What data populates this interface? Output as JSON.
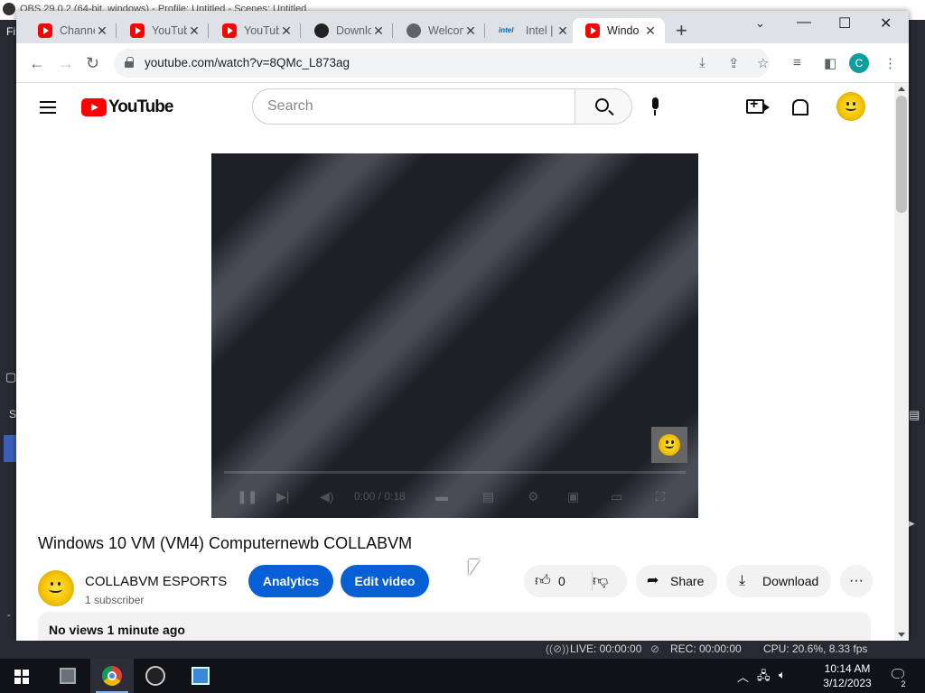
{
  "obs": {
    "title": "OBS 29.0.2 (64-bit, windows) - Profile: Untitled - Scenes: Untitled",
    "menu_label": "Fi",
    "status": {
      "live": "LIVE: 00:00:00",
      "rec": "REC: 00:00:00",
      "cpu": "CPU: 20.6%, 8.33 fps"
    }
  },
  "browser": {
    "tabs": [
      {
        "label": "Channel",
        "favicon": "youtube-icon"
      },
      {
        "label": "YouTube",
        "favicon": "youtube-icon"
      },
      {
        "label": "YouTube",
        "favicon": "youtube-icon"
      },
      {
        "label": "Download",
        "favicon": "obs-icon"
      },
      {
        "label": "Welcome",
        "favicon": "globe-icon"
      },
      {
        "label": "Intel | D",
        "favicon": "intel-icon"
      },
      {
        "label": "Windo",
        "favicon": "youtube-icon",
        "active": true
      }
    ],
    "new_tab": "+",
    "url": "youtube.com/watch?v=8QMc_L873ag",
    "profile_initial": "C",
    "accent_color": "#0f9d9d"
  },
  "youtube": {
    "logo_text": "YouTube",
    "search_placeholder": "Search",
    "video": {
      "title": "Windows 10 VM (VM4) Computernewb COLLABVM",
      "time": "0:00 / 0:18"
    },
    "channel": {
      "name": "COLLABVM ESPORTS",
      "subscribers": "1 subscriber"
    },
    "buttons": {
      "analytics": "Analytics",
      "edit": "Edit video",
      "likes": "0",
      "share": "Share",
      "download": "Download"
    },
    "description": {
      "meta": "No views  1 minute ago"
    },
    "colors": {
      "brand": "#ff0000",
      "primary_button": "#065fd4"
    }
  },
  "taskbar": {
    "clock_time": "10:14 AM",
    "clock_date": "3/12/2023",
    "notification_count": "2"
  }
}
